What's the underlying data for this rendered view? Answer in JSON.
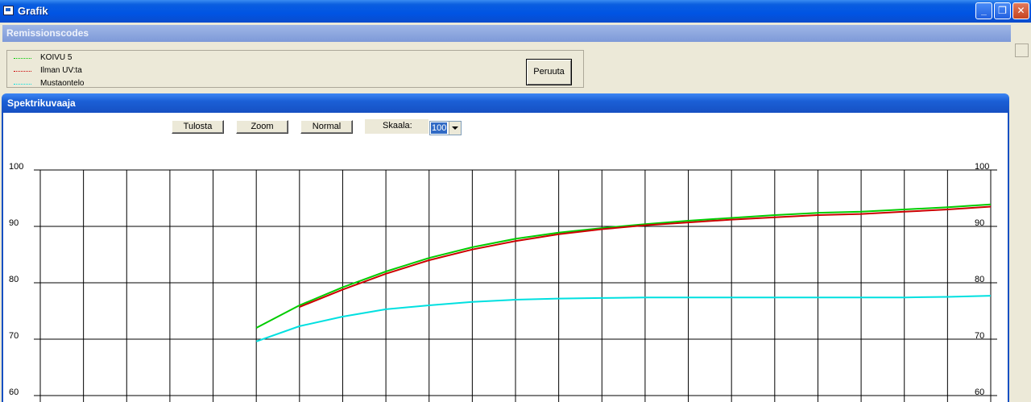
{
  "window": {
    "title": "Grafik"
  },
  "remission": {
    "header": "Remissionscodes",
    "legend": [
      {
        "label": "KOIVU 5",
        "color": "#00cc00"
      },
      {
        "label": "Ilman UV:ta",
        "color": "#cc0000"
      },
      {
        "label": "Mustaontelo",
        "color": "#00e0e0"
      }
    ],
    "cancel_label": "Peruuta"
  },
  "spektri": {
    "header": "Spektrikuvaaja",
    "toolbar": {
      "print_label": "Tulosta",
      "zoom_label": "Zoom",
      "normal_label": "Normal",
      "scale_label": "Skaala:",
      "scale_value": "100"
    }
  },
  "chart_data": {
    "type": "line",
    "y_ticks": [
      100,
      90,
      80,
      70,
      60
    ],
    "ylim": [
      60,
      100
    ],
    "x_columns": 22,
    "grid": true,
    "series": [
      {
        "name": "KOIVU 5",
        "color": "#00cc00",
        "points": [
          [
            5,
            72
          ],
          [
            6,
            76
          ],
          [
            7,
            79.2
          ],
          [
            8,
            82
          ],
          [
            9,
            84.4
          ],
          [
            10,
            86.3
          ],
          [
            11,
            87.8
          ],
          [
            12,
            88.9
          ],
          [
            13,
            89.7
          ],
          [
            14,
            90.4
          ],
          [
            15,
            91
          ],
          [
            16,
            91.5
          ],
          [
            17,
            92
          ],
          [
            18,
            92.4
          ],
          [
            19,
            92.6
          ],
          [
            20,
            93
          ],
          [
            21,
            93.4
          ],
          [
            22,
            93.9
          ]
        ]
      },
      {
        "name": "Ilman UV:ta",
        "color": "#cc0000",
        "points": [
          [
            6,
            75.7
          ],
          [
            7,
            78.8
          ],
          [
            8,
            81.6
          ],
          [
            9,
            84
          ],
          [
            10,
            85.9
          ],
          [
            11,
            87.4
          ],
          [
            12,
            88.6
          ],
          [
            13,
            89.5
          ],
          [
            14,
            90.2
          ],
          [
            15,
            90.7
          ],
          [
            16,
            91.2
          ],
          [
            17,
            91.6
          ],
          [
            18,
            92
          ],
          [
            19,
            92.2
          ],
          [
            20,
            92.6
          ],
          [
            21,
            93
          ],
          [
            22,
            93.5
          ]
        ]
      },
      {
        "name": "Mustaontelo",
        "color": "#00e0e0",
        "points": [
          [
            5,
            69.6
          ],
          [
            6,
            72.3
          ],
          [
            7,
            74
          ],
          [
            8,
            75.3
          ],
          [
            9,
            76
          ],
          [
            10,
            76.6
          ],
          [
            11,
            77
          ],
          [
            12,
            77.2
          ],
          [
            13,
            77.3
          ],
          [
            14,
            77.4
          ],
          [
            15,
            77.4
          ],
          [
            16,
            77.4
          ],
          [
            17,
            77.4
          ],
          [
            18,
            77.4
          ],
          [
            19,
            77.4
          ],
          [
            20,
            77.4
          ],
          [
            21,
            77.5
          ],
          [
            22,
            77.7
          ]
        ]
      }
    ]
  }
}
